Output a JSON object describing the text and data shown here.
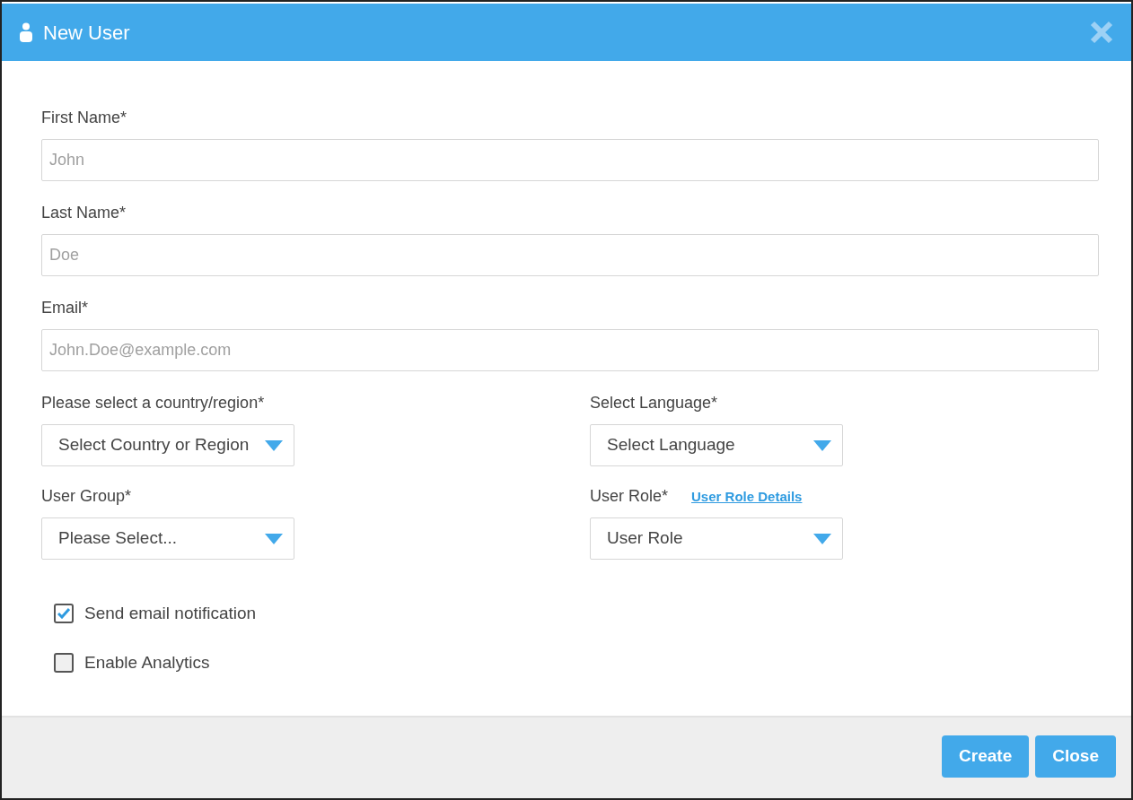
{
  "dialog": {
    "title": "New User"
  },
  "text_fields": [
    {
      "label": "First Name*",
      "placeholder": "John"
    },
    {
      "label": "Last Name*",
      "placeholder": "Doe"
    },
    {
      "label": "Email*",
      "placeholder": "John.Doe@example.com"
    }
  ],
  "selects": [
    {
      "label": "Please select a country/region*",
      "value": "Select Country or Region"
    },
    {
      "label": "Select Language*",
      "value": "Select Language"
    },
    {
      "label": "User Group*",
      "value": "Please Select..."
    },
    {
      "label": "User Role*",
      "value": "User Role",
      "link": "User Role Details"
    }
  ],
  "checkboxes": [
    {
      "label": "Send email notification",
      "checked": true
    },
    {
      "label": "Enable Analytics",
      "checked": false
    }
  ],
  "buttons": [
    "Create",
    "Close"
  ]
}
